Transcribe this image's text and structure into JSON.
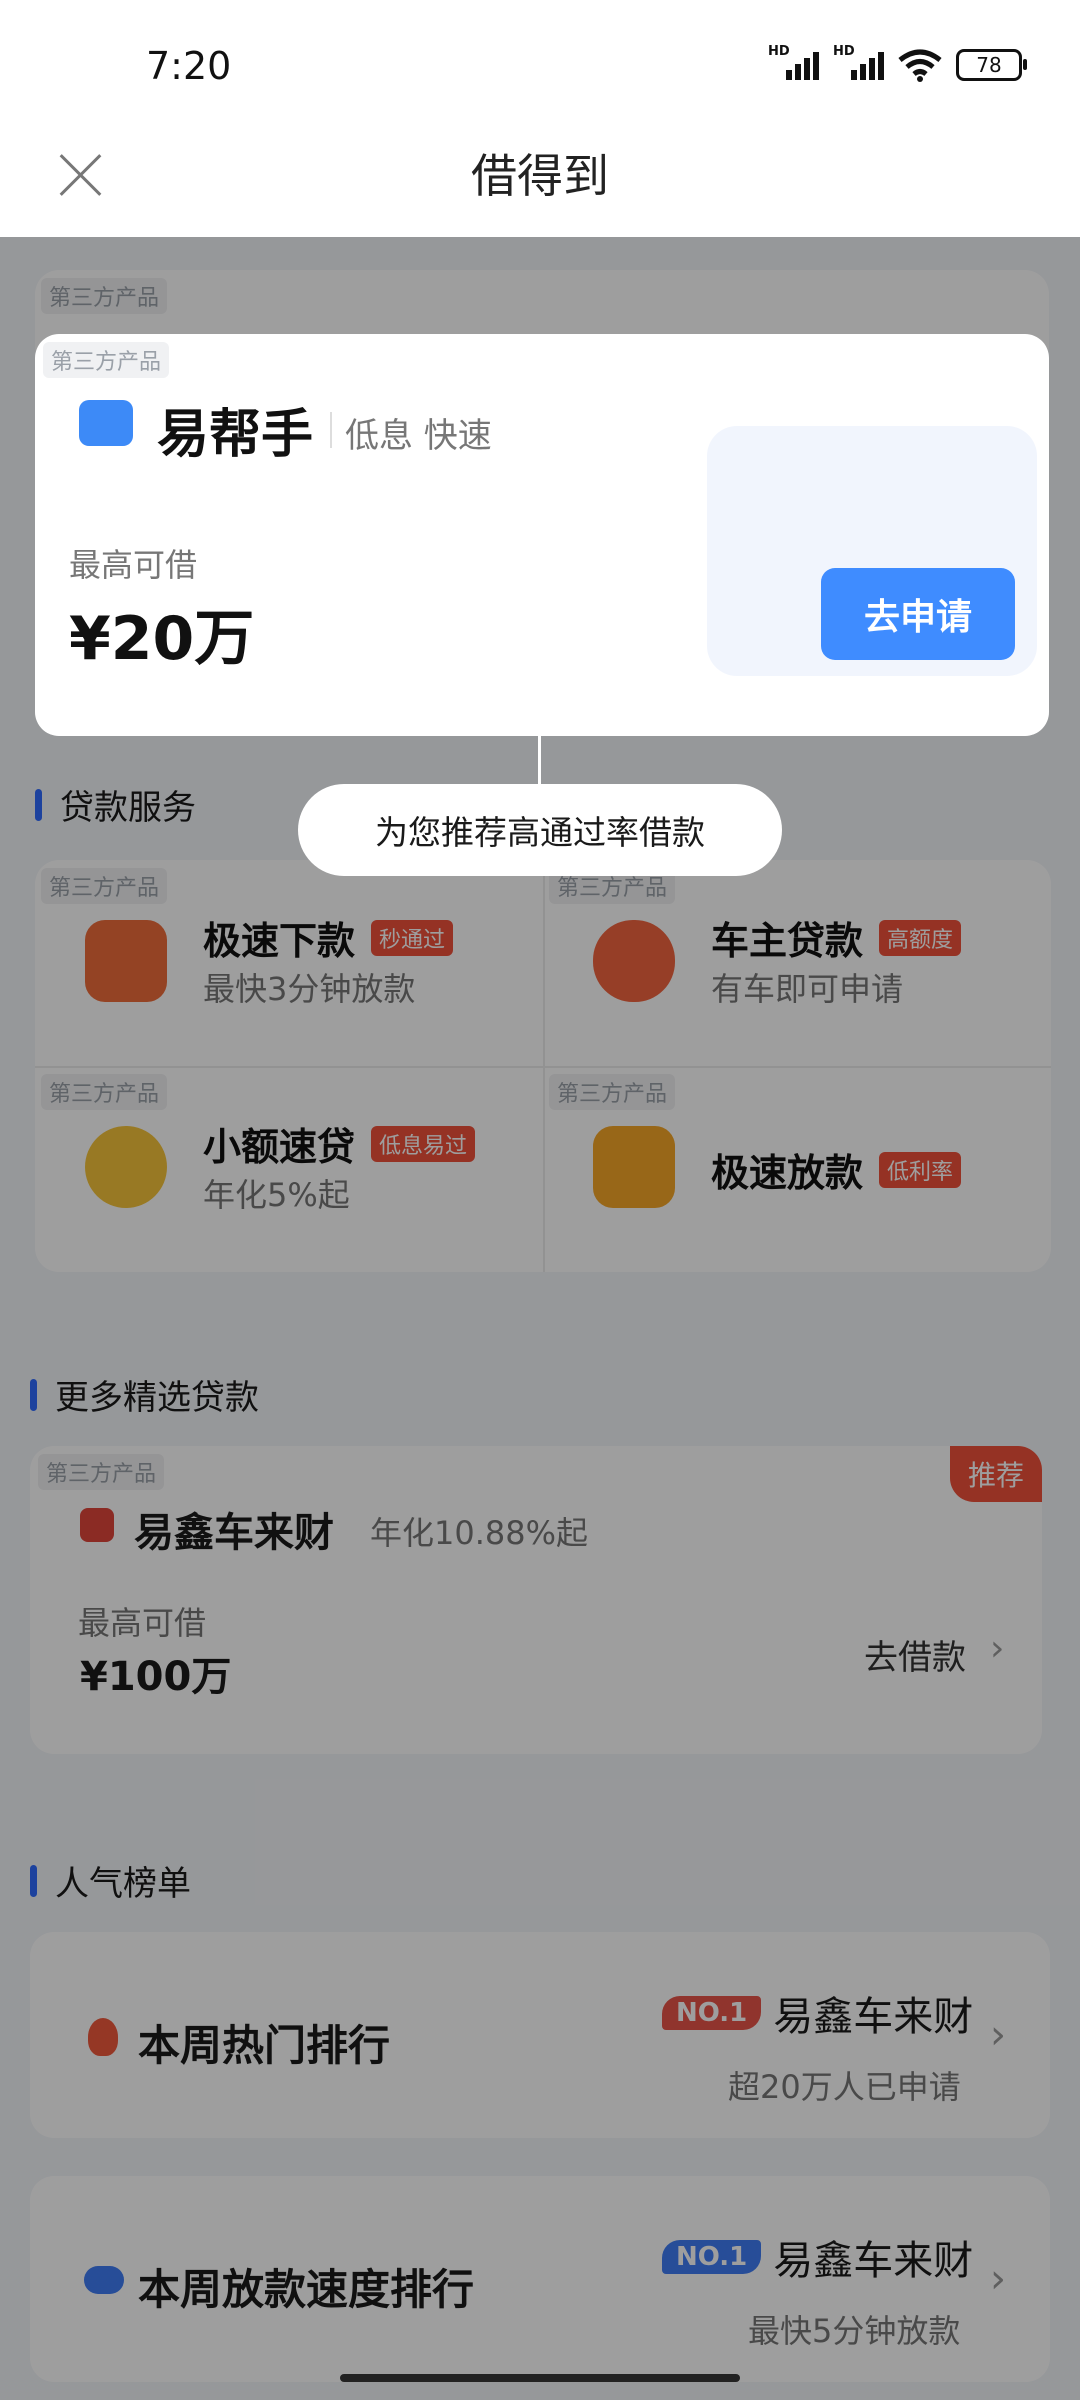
{
  "status": {
    "time": "7:20",
    "battery": "78",
    "hd1": "HD",
    "hd2": "HD"
  },
  "nav": {
    "title": "借得到"
  },
  "third_party_label": "第三方产品",
  "promo": {
    "name": "易帮手",
    "tags": "低息 快速",
    "max_label": "最高可借",
    "max_amount": "¥20万",
    "apply": "去申请"
  },
  "tooltip": "为您推荐高通过率借款",
  "loan_services": {
    "title": "贷款服务",
    "items": [
      {
        "title": "极速下款",
        "badge": "秒通过",
        "sub": "最快3分钟放款"
      },
      {
        "title": "车主贷款",
        "badge": "高额度",
        "sub": "有车即可申请"
      },
      {
        "title": "小额速贷",
        "badge": "低息易过",
        "sub": "年化5%起"
      },
      {
        "title": "极速放款",
        "badge": "低利率",
        "sub": ""
      }
    ]
  },
  "more": {
    "title": "更多精选贷款",
    "product": "易鑫车来财",
    "rate": "年化10.88%起",
    "recommend": "推荐",
    "max_label": "最高可借",
    "max_amount": "¥100万",
    "action": "去借款"
  },
  "ranking": {
    "title": "人气榜单",
    "items": [
      {
        "label": "本周热门排行",
        "no": "NO.1",
        "product": "易鑫车来财",
        "sub": "超20万人已申请",
        "badge_color": "#e8544a"
      },
      {
        "label": "本周放款速度排行",
        "no": "NO.1",
        "product": "易鑫车来财",
        "sub": "最快5分钟放款",
        "badge_color": "#3f7df5"
      }
    ]
  }
}
